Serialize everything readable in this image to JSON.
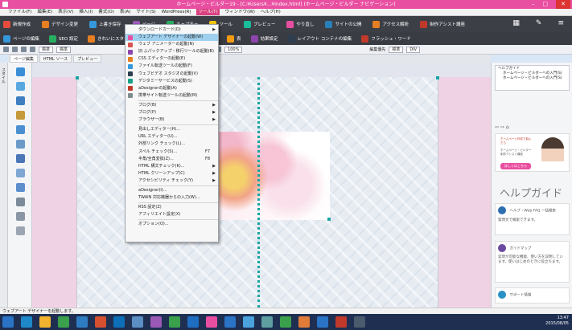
{
  "titlebar": {
    "text": "ホームページ・ビルダー19 - [C:¥Users¥...¥index.html] (ホームページ・ビルダー ナビゲーション)"
  },
  "menubar": {
    "items": [
      "ファイル(F)",
      "編集(E)",
      "表示(V)",
      "挿入(I)",
      "書式(O)",
      "表(A)",
      "サイト(S)",
      "WordPress(R)",
      "ツール(T)",
      "ウィンドウ(W)",
      "ヘルプ(H)"
    ],
    "active_index": 8
  },
  "toolbar1": {
    "items": [
      "新規作成",
      "デザイン変更",
      "上書き保存",
      "ページ",
      "キャプチャ",
      "ツール",
      "プレビュー",
      "やり直し",
      "サイトの公開",
      "アクセス解析",
      "制作アシスト講座"
    ]
  },
  "toolbar2": {
    "items": [
      "ページの編集",
      "SEO 設定",
      "きれいにスタイル",
      "挿入",
      "段落",
      "画像",
      "表",
      "効果設定",
      "レイアウト コンテナの編集",
      "フラッシュ・ワード"
    ]
  },
  "toolbar3": {
    "style_select": "標準",
    "size_select": "標準",
    "zoom_select": "100%",
    "right_label": "編集優先",
    "right_select1": "標準",
    "right_select2": "DIV"
  },
  "tabs": {
    "items": [
      "ページ編集",
      "HTML ソース",
      "プレビュー"
    ],
    "active_index": 0
  },
  "leftbar": {
    "label": "スタイル"
  },
  "dropdown": {
    "items": [
      {
        "label": "ダウンロードカード(D)",
        "arrow": true
      },
      {
        "label": "ウェブアート デザイナーの起動(W)",
        "highlight": true,
        "color": "#e94fa1"
      },
      {
        "label": "ウェブ アニメーターの起動(N)",
        "color": "#d9534f"
      },
      {
        "label": "旧 ふパックアップ・移行ツールの起動(B)",
        "color": "#8e44ad"
      },
      {
        "label": "CSS エディターの起動(E)",
        "color": "#e67e22"
      },
      {
        "label": "ファイル転送ツールの起動(F)",
        "color": "#3498db"
      },
      {
        "label": "ウェブビデオ スタジオの起動(V)",
        "color": "#2c3e50"
      },
      {
        "label": "デジタミーサービスの起動(S)",
        "color": "#16a085"
      },
      {
        "label": "aDesignerの起動(A)",
        "color": "#c0392b"
      },
      {
        "label": "携帯サイト転送ツールの起動(M)",
        "color": "#7f8c8d"
      },
      {
        "sep": true
      },
      {
        "label": "ブログ(B)",
        "arrow": true
      },
      {
        "label": "ブログ(P)",
        "arrow": true
      },
      {
        "label": "ブラウザー(B)",
        "arrow": true
      },
      {
        "sep": true
      },
      {
        "label": "見出しエディター(H)..."
      },
      {
        "label": "URL エディター(U)..."
      },
      {
        "label": "外部リンク チェック(L)..."
      },
      {
        "label": "スペル チェック(S)...",
        "shortcut": "F7"
      },
      {
        "label": "半角/全角変換(Z)...",
        "shortcut": "F8"
      },
      {
        "label": "HTML 構文チェック(K)...",
        "arrow": true
      },
      {
        "label": "HTML クリーンアップ(C)",
        "arrow": true
      },
      {
        "label": "アクセシビリティ チェック(Y)",
        "arrow": true
      },
      {
        "sep": true
      },
      {
        "label": "aDesigner(I)..."
      },
      {
        "label": "TWAIN 対応機器からの入力(W)..."
      },
      {
        "sep": true
      },
      {
        "label": "RSS 設定(Z)"
      },
      {
        "label": "アフィリエイト設定(X)"
      },
      {
        "sep": true
      },
      {
        "label": "オプション(O)..."
      }
    ]
  },
  "rightpanel": {
    "tree": [
      "ヘルプガイド",
      "ホームページ・ビルダーへの入門(S)",
      "ホームページ・ビルダーへの入門(S)"
    ],
    "banner": {
      "title": "ホームページ作成で悩んだら",
      "subtitle": "ホームページ・ビルダー 制作アシスト講座",
      "button": "詳しくはこちら"
    },
    "help_title": "ヘルプガイド",
    "cards": [
      {
        "title": "ヘルプ・Web FAQ 一括検索",
        "desc": "質問文で検索できます。",
        "color": "#2c6fb0"
      },
      {
        "title": "ガイドマップ",
        "desc": "実現が可能な機能、使い方を説明しています。使いはじめのときに役立ちます。",
        "color": "#6b4aa0"
      },
      {
        "title": "サポート情報",
        "desc": "",
        "color": "#2a8fc4"
      }
    ]
  },
  "statusbar": {
    "text": "ウェブアート デザイナーを起動します。"
  },
  "tray": {
    "time": "13:47",
    "date": "2015/08/05"
  },
  "taskbar_icons": [
    "#2a73c5",
    "#1e88c9",
    "#f2b22e",
    "#3aa04b",
    "#2d7cc1",
    "#d4502f",
    "#0d6fb8",
    "#5b8fc4",
    "#9b59b6",
    "#3aa04b",
    "#1f6dc0",
    "#e94fa1",
    "#2a73c5",
    "#4aa3df",
    "#5f9ea0",
    "#3aa04b",
    "#e07b39",
    "#2a73c5",
    "#c0392b",
    "#4b5b6e"
  ]
}
